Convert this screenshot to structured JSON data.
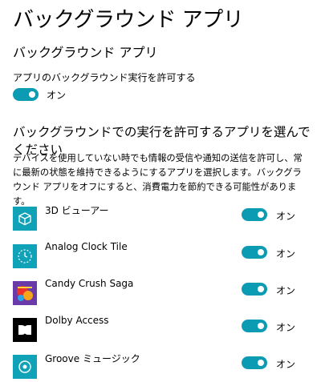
{
  "page": {
    "title": "バックグラウンド アプリ",
    "section_title": "バックグラウンド アプリ",
    "allow_label": "アプリのバックグラウンド実行を許可する",
    "allow_state": "オン",
    "choose_title": "バックグラウンドでの実行を許可するアプリを選んでください",
    "description": "デバイスを使用していない時でも情報の受信や通知の送信を許可し、常に最新の状態を維持できるようにするアプリを選択します。バックグラウンド アプリをオフにすると、消費電力を節約できる可能性があります。"
  },
  "colors": {
    "accent": "#0b9bb3",
    "app_tile": "#10a3b8"
  },
  "apps": [
    {
      "name": "3D ビューアー",
      "state": "オン",
      "icon": "cube-icon"
    },
    {
      "name": "Analog Clock Tile",
      "state": "オン",
      "icon": "clock-icon"
    },
    {
      "name": "Candy Crush Saga",
      "state": "オン",
      "icon": "candy-crush-icon"
    },
    {
      "name": "Dolby Access",
      "state": "オン",
      "icon": "dolby-icon"
    },
    {
      "name": "Groove ミュージック",
      "state": "オン",
      "icon": "groove-music-icon"
    }
  ]
}
